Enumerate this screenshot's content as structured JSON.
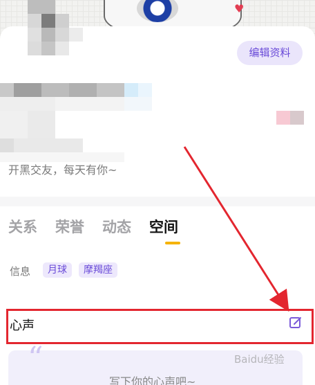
{
  "profile": {
    "edit_button": "编辑资料",
    "bio": "开黑交友，每天有你~"
  },
  "tabs": [
    {
      "label": "关系",
      "active": false
    },
    {
      "label": "荣誉",
      "active": false
    },
    {
      "label": "动态",
      "active": false
    },
    {
      "label": "空间",
      "active": true
    }
  ],
  "info": {
    "label": "信息",
    "tags": [
      "月球",
      "摩羯座"
    ]
  },
  "voice": {
    "title": "心声",
    "placeholder": "写下你的心声吧~",
    "quote_mark": "“"
  },
  "watermark": "Baidu经验",
  "colors": {
    "accent": "#6a4bd8",
    "tab_indicator": "#f5b301",
    "annotation": "#e3262f"
  }
}
